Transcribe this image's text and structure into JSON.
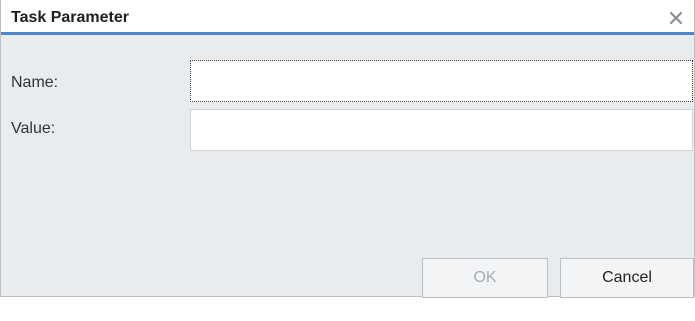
{
  "dialog": {
    "title": "Task Parameter",
    "close_icon": "close-icon"
  },
  "form": {
    "name_label": "Name:",
    "name_value": "",
    "value_label": "Value:",
    "value_value": ""
  },
  "buttons": {
    "ok_label": "OK",
    "ok_enabled": false,
    "cancel_label": "Cancel"
  },
  "colors": {
    "accent": "#4f86c9",
    "background": "#e9ecef"
  }
}
